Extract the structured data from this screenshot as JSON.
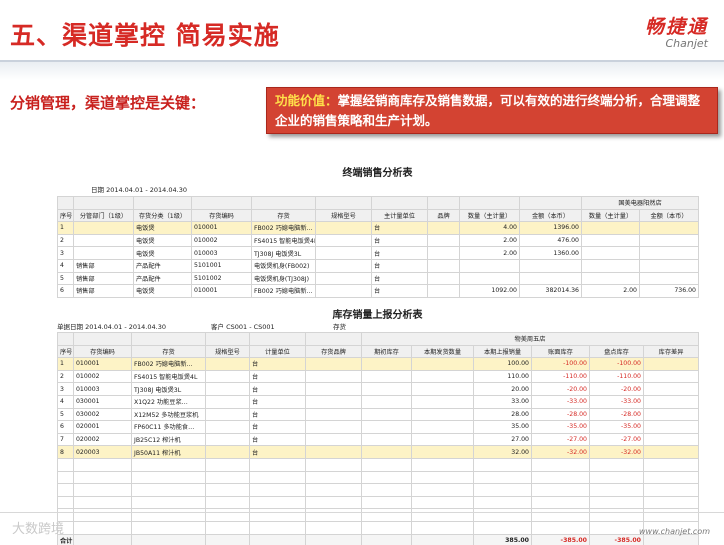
{
  "header": {
    "title": "五、渠道掌控 简易实施",
    "brand_cn": "畅捷通",
    "brand_en": "Chanjet"
  },
  "lead": "分销管理，渠道掌控是关键：",
  "callout": {
    "label": "功能价值：",
    "text": "掌握经销商库存及销售数据，可以有效的进行终端分析，合理调整企业的销售策略和生产计划。"
  },
  "report1": {
    "title": "终端销售分析表",
    "date": "日期 2014.04.01 - 2014.04.30",
    "group_header": "国美电器阳然店",
    "columns": [
      "序号",
      "分管部门（1级）",
      "存货分类（1级）",
      "存货编码",
      "存货",
      "规格型号",
      "主计量单位",
      "品牌",
      "数量（主计量）",
      "金额（本币）",
      "数量（主计量）",
      "金额（本币）"
    ],
    "rows": [
      [
        "1",
        "",
        "电饭煲",
        "010001",
        "FB002 巧媳电脑新…",
        "",
        "台",
        "",
        "4.00",
        "1396.00",
        "",
        ""
      ],
      [
        "2",
        "",
        "电饭煲",
        "010002",
        "FS4015 智能电饭煲4L",
        "",
        "台",
        "",
        "2.00",
        "476.00",
        "",
        ""
      ],
      [
        "3",
        "",
        "电饭煲",
        "010003",
        "TJ308J 电饭煲3L",
        "",
        "台",
        "",
        "2.00",
        "1360.00",
        "",
        ""
      ],
      [
        "4",
        "销售部",
        "产品配件",
        "5101001",
        "电饭煲机身(FB002)",
        "",
        "台",
        "",
        "",
        "",
        "",
        ""
      ],
      [
        "5",
        "销售部",
        "产品配件",
        "5101002",
        "电饭煲机身(TJ308J)",
        "",
        "台",
        "",
        "",
        "",
        "",
        ""
      ],
      [
        "6",
        "销售部",
        "电饭煲",
        "010001",
        "FB002 巧媳电脑新…",
        "",
        "台",
        "",
        "1092.00",
        "382014.36",
        "2.00",
        "736.00"
      ]
    ]
  },
  "report2": {
    "title": "库存销量上报分析表",
    "date": "单据日期 2014.04.01 - 2014.04.30",
    "customer": "客户 CS001 - CS001",
    "inventory": "存货",
    "group_header": "物美周五店",
    "columns": [
      "序号",
      "存货编码",
      "存货",
      "规格型号",
      "计量单位",
      "存货品牌",
      "期初库存",
      "本期发货数量",
      "本期上报销量",
      "账面库存",
      "盘点库存",
      "库存差异"
    ],
    "rows": [
      [
        "1",
        "010001",
        "FB002 巧媳电脑新…",
        "",
        "台",
        "",
        "",
        "",
        "100.00",
        "-100.00",
        "-100.00",
        ""
      ],
      [
        "2",
        "010002",
        "FS4015 智能电饭煲4L",
        "",
        "台",
        "",
        "",
        "",
        "110.00",
        "-110.00",
        "-110.00",
        ""
      ],
      [
        "3",
        "010003",
        "TJ308J 电饭煲3L",
        "",
        "台",
        "",
        "",
        "",
        "20.00",
        "-20.00",
        "-20.00",
        ""
      ],
      [
        "4",
        "030001",
        "X1Q22 功能豆浆…",
        "",
        "台",
        "",
        "",
        "",
        "33.00",
        "-33.00",
        "-33.00",
        ""
      ],
      [
        "5",
        "030002",
        "X12M52 多功能豆浆机",
        "",
        "台",
        "",
        "",
        "",
        "28.00",
        "-28.00",
        "-28.00",
        ""
      ],
      [
        "6",
        "020001",
        "FP60C11 多功能食…",
        "",
        "台",
        "",
        "",
        "",
        "35.00",
        "-35.00",
        "-35.00",
        ""
      ],
      [
        "7",
        "020002",
        "JB25C12 榨汁机",
        "",
        "台",
        "",
        "",
        "",
        "27.00",
        "-27.00",
        "-27.00",
        ""
      ],
      [
        "8",
        "020003",
        "JB50A11 榨汁机",
        "",
        "台",
        "",
        "",
        "",
        "32.00",
        "-32.00",
        "-32.00",
        ""
      ]
    ],
    "total": {
      "label": "合计",
      "reported": "385.00",
      "book": "-385.00",
      "count": "-385.00"
    }
  },
  "footer": {
    "watermark": "大数跨境",
    "site": "www.chanjet.com"
  }
}
